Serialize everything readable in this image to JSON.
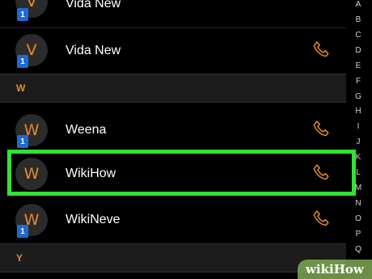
{
  "contacts_top": [
    {
      "initial": "V",
      "name": "Vida New",
      "sim_badge": "1"
    },
    {
      "initial": "V",
      "name": "Vida New",
      "sim_badge": "1"
    }
  ],
  "section_w": {
    "letter": "W"
  },
  "contacts_w": [
    {
      "initial": "W",
      "name": "Weena",
      "sim_badge": "1"
    },
    {
      "initial": "W",
      "name": "WikiHow",
      "sim_badge": ""
    },
    {
      "initial": "W",
      "name": "WikiNeve",
      "sim_badge": "1"
    }
  ],
  "section_y": {
    "letter": "Y"
  },
  "index_letters": [
    "A",
    "B",
    "C",
    "D",
    "E",
    "F",
    "G",
    "H",
    "I",
    "J",
    "K",
    "L",
    "M",
    "N",
    "O",
    "P",
    "Q"
  ],
  "colors": {
    "accent": "#e88a2e",
    "highlight": "#33e233",
    "badge": "#1f6ad1"
  },
  "watermark": {
    "text": "wikiHow"
  },
  "icons": {
    "call": "phone-icon"
  }
}
